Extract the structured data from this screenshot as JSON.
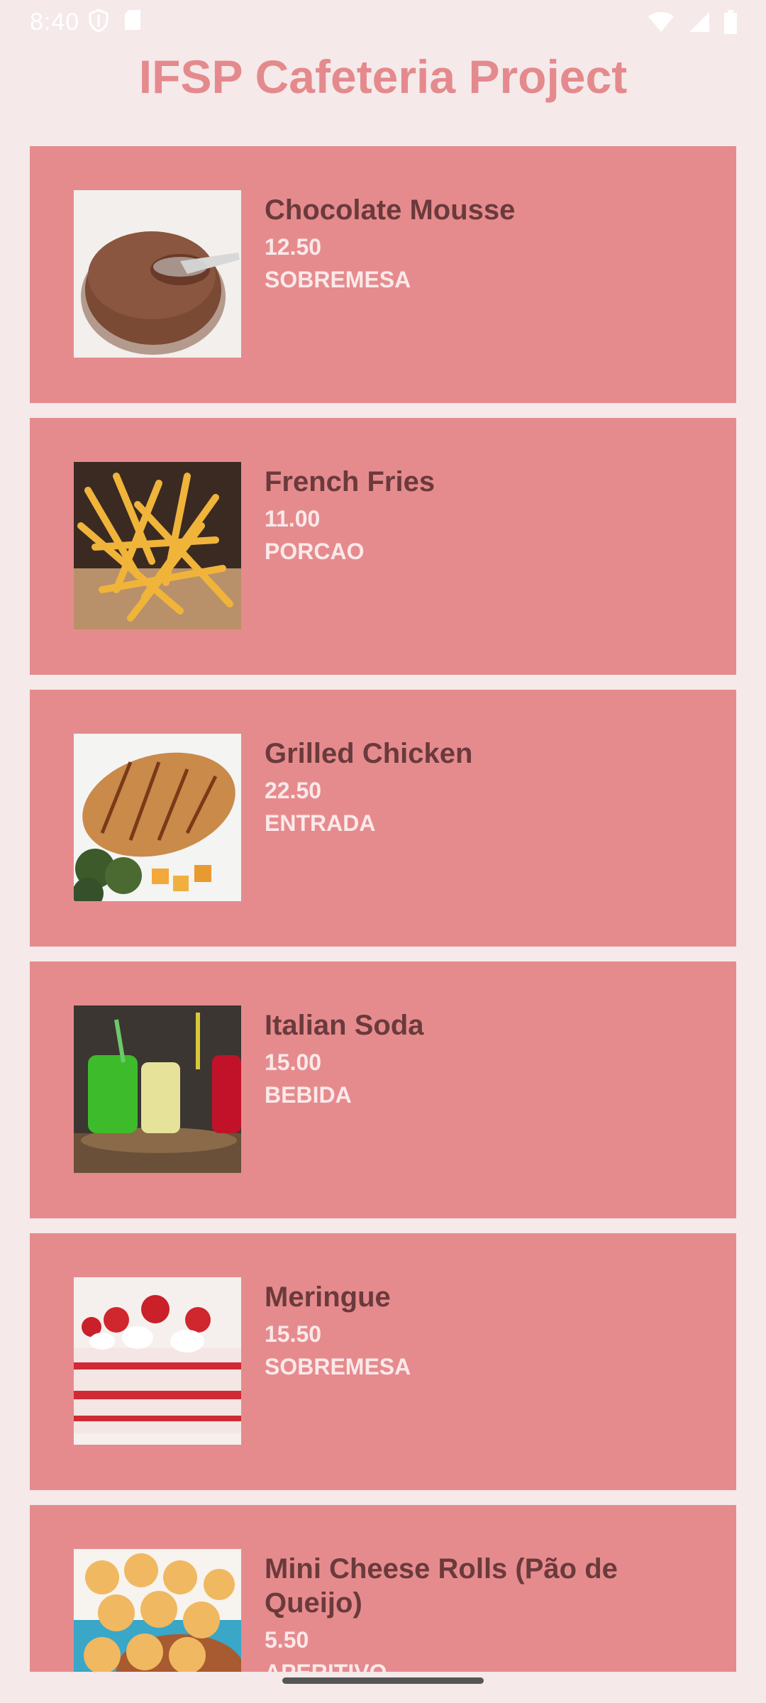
{
  "status_bar": {
    "time": "8:40",
    "left_icons": [
      "shield-icon",
      "sd-card-icon"
    ],
    "right_icons": [
      "wifi-icon",
      "signal-icon",
      "battery-icon"
    ]
  },
  "app": {
    "title": "IFSP Cafeteria Project"
  },
  "colors": {
    "background": "#f5e9ea",
    "card": "#e68b8d",
    "title": "#e48a8d",
    "name_text": "#6a3a3c",
    "detail_text": "#fbe9ea"
  },
  "items": [
    {
      "name": "Chocolate Mousse",
      "price": "12.50",
      "category": "SOBREMESA",
      "image": "chocolate-mousse-image"
    },
    {
      "name": "French Fries",
      "price": "11.00",
      "category": "PORCAO",
      "image": "french-fries-image"
    },
    {
      "name": "Grilled Chicken",
      "price": "22.50",
      "category": "ENTRADA",
      "image": "grilled-chicken-image"
    },
    {
      "name": "Italian Soda",
      "price": "15.00",
      "category": "BEBIDA",
      "image": "italian-soda-image"
    },
    {
      "name": "Meringue",
      "price": "15.50",
      "category": "SOBREMESA",
      "image": "meringue-image"
    },
    {
      "name": "Mini Cheese Rolls (Pão de Queijo)",
      "price": "5.50",
      "category": "APERITIVO",
      "image": "cheese-rolls-image"
    }
  ]
}
